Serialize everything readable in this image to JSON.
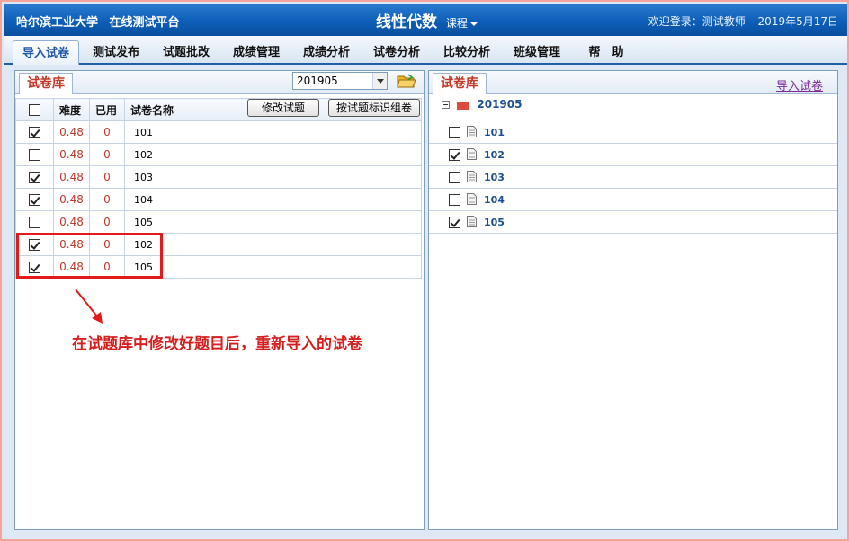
{
  "header": {
    "university": "哈尔滨工业大学",
    "platform": "在线测试平台",
    "course_title": "线性代数",
    "course_menu": "课程",
    "welcome": "欢迎登录：测试教师",
    "date": "2019年5月17日"
  },
  "nav": {
    "tabs": [
      {
        "label": "导入试卷",
        "active": true
      },
      {
        "label": "测试发布"
      },
      {
        "label": "试题批改"
      },
      {
        "label": "成绩管理"
      },
      {
        "label": "成绩分析"
      },
      {
        "label": "试卷分析"
      },
      {
        "label": "比较分析"
      },
      {
        "label": "班级管理"
      },
      {
        "label": "帮　助"
      }
    ]
  },
  "left_panel": {
    "title": "试卷库",
    "year_select": "201905",
    "columns": {
      "difficulty": "难度",
      "used": "已用",
      "name": "试卷名称"
    },
    "buttons": {
      "edit": "修改试题",
      "compose": "按试题标识组卷"
    },
    "rows": [
      {
        "checked": true,
        "difficulty": "0.48",
        "used": "0",
        "name": "101"
      },
      {
        "checked": false,
        "difficulty": "0.48",
        "used": "0",
        "name": "102"
      },
      {
        "checked": true,
        "difficulty": "0.48",
        "used": "0",
        "name": "103"
      },
      {
        "checked": true,
        "difficulty": "0.48",
        "used": "0",
        "name": "104"
      },
      {
        "checked": false,
        "difficulty": "0.48",
        "used": "0",
        "name": "105"
      },
      {
        "checked": true,
        "difficulty": "0.48",
        "used": "0",
        "name": "102"
      },
      {
        "checked": true,
        "difficulty": "0.48",
        "used": "0",
        "name": "105"
      }
    ]
  },
  "annotation": {
    "text": "在试题库中修改好题目后，重新导入的试卷",
    "color": "#e31a1a"
  },
  "right_panel": {
    "title": "试卷库",
    "import_link": "导入试卷",
    "folder": "201905",
    "items": [
      {
        "checked": false,
        "name": "101"
      },
      {
        "checked": true,
        "name": "102"
      },
      {
        "checked": false,
        "name": "103"
      },
      {
        "checked": false,
        "name": "104"
      },
      {
        "checked": true,
        "name": "105"
      }
    ]
  },
  "colors": {
    "header_blue": "#0d5eb8",
    "accent_red": "#c0392b",
    "link_purple": "#7b2a97",
    "tree_blue": "#1a4f8f"
  }
}
